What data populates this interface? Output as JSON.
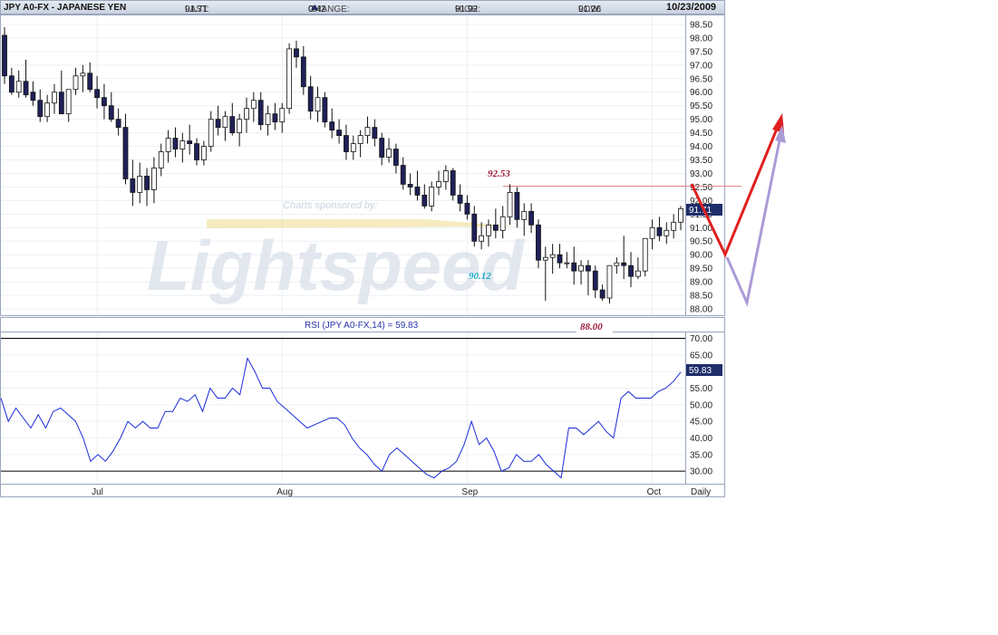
{
  "header": {
    "symbol": "JPY A0-FX - JAPANESE YEN",
    "last_label": "LAST:",
    "last_value": "91.71",
    "change_label": "CHANGE:",
    "change_value": "0.42",
    "high_label": "HIGH:",
    "high_value": "91.92",
    "low_label": "LOW:",
    "low_value": "91.26",
    "date": "10/23/2009"
  },
  "colors": {
    "down_candle": "#1f2158",
    "up_candle": "#ffffff",
    "rsi_line": "#1a2ad8",
    "last_price_tag": "#1f2d6b",
    "resistance_line": "#e88888",
    "annotation_label": "#9b1d3a",
    "support_label": "#1ba9c9",
    "arrow_red": "#e02020",
    "arrow_lavender": "#ab9bd6"
  },
  "watermark": {
    "sponsor": "Charts sponsored by:",
    "brand": "Lightspeed"
  },
  "annotations": {
    "resistance": "92.53",
    "support": "90.12",
    "low_target": "88.00"
  },
  "chart_data": [
    {
      "type": "candlestick",
      "title": "JPY A0-FX - JAPANESE YEN",
      "period_label": "Daily",
      "last_price_tag": "91.71",
      "ylim": [
        87.8,
        98.8
      ],
      "y_ticks": [
        "88.00",
        "88.50",
        "89.00",
        "89.50",
        "90.00",
        "90.50",
        "91.00",
        "91.50",
        "92.00",
        "92.50",
        "93.00",
        "93.50",
        "94.00",
        "94.50",
        "95.00",
        "95.50",
        "96.00",
        "96.50",
        "97.00",
        "97.50",
        "98.00",
        "98.50"
      ],
      "x_ticks": [
        {
          "label": "Jul",
          "index": 13
        },
        {
          "label": "Aug",
          "index": 39
        },
        {
          "label": "Sep",
          "index": 65
        },
        {
          "label": "Oct",
          "index": 91
        }
      ],
      "ohlc": [
        [
          98.1,
          98.4,
          96.3,
          96.6
        ],
        [
          96.6,
          96.9,
          95.9,
          96.0
        ],
        [
          96.0,
          96.8,
          95.8,
          96.4
        ],
        [
          96.4,
          97.2,
          95.8,
          95.9
        ],
        [
          96.0,
          96.4,
          95.5,
          95.7
        ],
        [
          95.7,
          96.1,
          94.9,
          95.1
        ],
        [
          95.1,
          95.9,
          94.9,
          95.6
        ],
        [
          95.6,
          96.3,
          95.2,
          96.0
        ],
        [
          96.0,
          96.8,
          95.8,
          95.2
        ],
        [
          95.2,
          96.1,
          94.9,
          96.1
        ],
        [
          96.1,
          96.9,
          95.9,
          96.6
        ],
        [
          96.6,
          97.0,
          96.0,
          96.7
        ],
        [
          96.7,
          97.1,
          96.0,
          96.1
        ],
        [
          96.1,
          96.6,
          95.4,
          95.8
        ],
        [
          95.8,
          96.3,
          95.0,
          95.5
        ],
        [
          95.5,
          96.0,
          94.9,
          95.0
        ],
        [
          95.0,
          95.4,
          94.4,
          94.7
        ],
        [
          94.7,
          95.2,
          92.6,
          92.8
        ],
        [
          92.8,
          93.5,
          91.8,
          92.3
        ],
        [
          92.3,
          93.4,
          91.9,
          92.9
        ],
        [
          92.9,
          93.2,
          91.8,
          92.4
        ],
        [
          92.4,
          93.6,
          91.9,
          93.2
        ],
        [
          93.2,
          94.1,
          92.9,
          93.8
        ],
        [
          93.8,
          94.6,
          93.4,
          94.3
        ],
        [
          94.3,
          94.7,
          93.6,
          93.9
        ],
        [
          93.9,
          94.5,
          93.4,
          94.2
        ],
        [
          94.2,
          94.8,
          93.7,
          94.1
        ],
        [
          94.1,
          94.3,
          93.3,
          93.5
        ],
        [
          93.5,
          94.2,
          93.3,
          94.0
        ],
        [
          94.0,
          95.3,
          93.8,
          95.0
        ],
        [
          95.0,
          95.5,
          94.4,
          94.7
        ],
        [
          94.7,
          95.3,
          94.2,
          95.1
        ],
        [
          95.1,
          95.6,
          94.4,
          94.5
        ],
        [
          94.5,
          95.2,
          94.0,
          95.0
        ],
        [
          95.0,
          95.8,
          94.5,
          95.4
        ],
        [
          95.4,
          96.0,
          94.9,
          95.7
        ],
        [
          95.7,
          96.0,
          94.6,
          94.8
        ],
        [
          94.8,
          95.5,
          94.4,
          95.2
        ],
        [
          95.2,
          95.6,
          94.6,
          94.9
        ],
        [
          94.9,
          95.6,
          94.5,
          95.4
        ],
        [
          95.4,
          97.8,
          95.2,
          97.6
        ],
        [
          97.6,
          97.9,
          96.9,
          97.3
        ],
        [
          97.3,
          97.7,
          95.9,
          96.2
        ],
        [
          96.2,
          96.6,
          95.0,
          95.3
        ],
        [
          95.3,
          96.2,
          94.9,
          95.8
        ],
        [
          95.8,
          96.0,
          94.7,
          94.9
        ],
        [
          94.9,
          95.4,
          94.3,
          94.6
        ],
        [
          94.6,
          95.0,
          94.1,
          94.4
        ],
        [
          94.4,
          94.8,
          93.5,
          93.8
        ],
        [
          93.8,
          94.4,
          93.5,
          94.1
        ],
        [
          94.1,
          94.6,
          93.6,
          94.4
        ],
        [
          94.4,
          95.1,
          94.1,
          94.7
        ],
        [
          94.7,
          95.0,
          94.0,
          94.3
        ],
        [
          94.3,
          94.5,
          93.3,
          93.6
        ],
        [
          93.6,
          94.3,
          93.4,
          93.9
        ],
        [
          93.9,
          94.1,
          93.0,
          93.3
        ],
        [
          93.3,
          93.6,
          92.4,
          92.6
        ],
        [
          92.6,
          93.0,
          92.2,
          92.5
        ],
        [
          92.5,
          93.1,
          92.0,
          92.2
        ],
        [
          92.2,
          92.6,
          91.7,
          91.8
        ],
        [
          91.8,
          92.7,
          91.6,
          92.5
        ],
        [
          92.5,
          93.1,
          92.2,
          92.7
        ],
        [
          92.7,
          93.3,
          92.4,
          93.1
        ],
        [
          93.1,
          93.2,
          92.0,
          92.2
        ],
        [
          92.2,
          92.6,
          91.6,
          91.9
        ],
        [
          91.9,
          92.2,
          91.3,
          91.5
        ],
        [
          91.5,
          91.8,
          90.3,
          90.5
        ],
        [
          90.5,
          91.2,
          90.2,
          90.7
        ],
        [
          90.7,
          91.3,
          90.3,
          91.1
        ],
        [
          91.1,
          91.7,
          90.6,
          90.9
        ],
        [
          90.9,
          91.8,
          90.6,
          91.4
        ],
        [
          91.4,
          92.6,
          91.1,
          92.3
        ],
        [
          92.3,
          92.5,
          91.0,
          91.3
        ],
        [
          91.3,
          91.9,
          90.7,
          91.6
        ],
        [
          91.6,
          91.9,
          90.8,
          91.1
        ],
        [
          91.1,
          91.3,
          89.5,
          89.8
        ],
        [
          89.8,
          90.3,
          88.3,
          89.9
        ],
        [
          89.9,
          90.4,
          89.3,
          90.0
        ],
        [
          90.0,
          90.4,
          89.5,
          89.7
        ],
        [
          89.7,
          90.1,
          89.5,
          89.7
        ],
        [
          89.7,
          90.3,
          88.9,
          89.4
        ],
        [
          89.4,
          89.8,
          88.9,
          89.6
        ],
        [
          89.6,
          89.8,
          88.5,
          89.4
        ],
        [
          89.4,
          89.6,
          88.4,
          88.7
        ],
        [
          88.7,
          88.9,
          88.3,
          88.4
        ],
        [
          88.4,
          89.6,
          88.2,
          89.6
        ],
        [
          89.6,
          89.9,
          89.3,
          89.7
        ],
        [
          89.7,
          90.7,
          89.1,
          89.6
        ],
        [
          89.6,
          90.1,
          88.8,
          89.2
        ],
        [
          89.2,
          89.9,
          89.1,
          89.4
        ],
        [
          89.4,
          90.5,
          89.2,
          90.6
        ],
        [
          90.6,
          91.3,
          90.2,
          91.0
        ],
        [
          91.0,
          91.4,
          90.5,
          90.7
        ],
        [
          90.7,
          91.2,
          90.4,
          90.9
        ],
        [
          90.9,
          91.5,
          90.6,
          91.2
        ],
        [
          91.2,
          91.8,
          90.9,
          91.7
        ]
      ]
    },
    {
      "type": "line",
      "title": "RSI (JPY A0-FX,14) = 59.83",
      "series": [
        {
          "values": [
            52,
            45,
            49,
            46,
            43,
            47,
            43,
            48,
            49,
            47,
            45,
            40,
            33,
            35,
            33,
            36,
            40,
            45,
            43,
            45,
            43,
            43,
            48,
            48,
            52,
            51,
            53,
            48,
            55,
            52,
            52,
            55,
            53,
            64,
            60,
            55,
            55,
            51,
            49,
            47,
            45,
            43,
            44,
            45,
            46,
            46,
            44,
            40,
            37,
            35,
            32,
            30,
            35,
            37,
            35,
            33,
            31,
            29,
            28,
            30,
            31,
            33,
            38,
            45,
            38,
            40,
            36,
            30,
            31,
            35,
            33,
            33,
            35,
            32,
            30,
            28,
            43,
            43,
            41,
            43,
            45,
            42,
            40,
            52,
            54,
            52,
            52,
            52,
            54,
            55,
            57,
            59.83
          ]
        }
      ],
      "ylim": [
        26.5,
        71.5
      ],
      "y_ticks": [
        "30.00",
        "35.00",
        "40.00",
        "45.00",
        "50.00",
        "55.00",
        "60.00",
        "65.00",
        "70.00"
      ],
      "reference_lines": [
        70,
        30
      ],
      "last_value_tag": "59.83"
    }
  ]
}
